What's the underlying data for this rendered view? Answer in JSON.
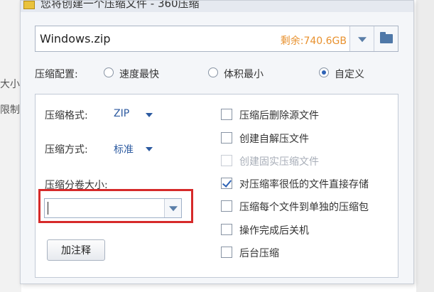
{
  "background": {
    "text_line_1": "大小",
    "text_line_2": "限制"
  },
  "dialog": {
    "title": "您将创建一个压缩文件 - 360压缩",
    "title_icon": "archive-icon"
  },
  "path": {
    "filename": "Windows.zip",
    "free_space": "剩余:740.6GB",
    "dropdown_icon": "chevron-down-icon",
    "browse_icon": "folder-icon"
  },
  "config": {
    "label": "压缩配置:",
    "options": [
      {
        "label": "速度最快",
        "selected": false
      },
      {
        "label": "体积最小",
        "selected": false
      },
      {
        "label": "自定义",
        "selected": true
      }
    ]
  },
  "settings": {
    "format_label": "压缩格式:",
    "format_value": "ZIP",
    "method_label": "压缩方式:",
    "method_value": "标准",
    "volume_label": "压缩分卷大小:",
    "volume_value": "",
    "comment_button": "加注释"
  },
  "options": [
    {
      "label": "压缩后删除源文件",
      "checked": false,
      "disabled": false
    },
    {
      "label": "创建自解压文件",
      "checked": false,
      "disabled": false
    },
    {
      "label": "创建固实压缩文件",
      "checked": false,
      "disabled": true
    },
    {
      "label": "对压缩率很低的文件直接存储",
      "checked": true,
      "disabled": false
    },
    {
      "label": "压缩每个文件到单独的压缩包",
      "checked": false,
      "disabled": false
    },
    {
      "label": "操作完成后关机",
      "checked": false,
      "disabled": false
    },
    {
      "label": "后台压缩",
      "checked": false,
      "disabled": false
    }
  ],
  "colors": {
    "free_space": "#e8912e",
    "accent": "#2c5aa0",
    "highlight_box": "#d62a2a"
  }
}
